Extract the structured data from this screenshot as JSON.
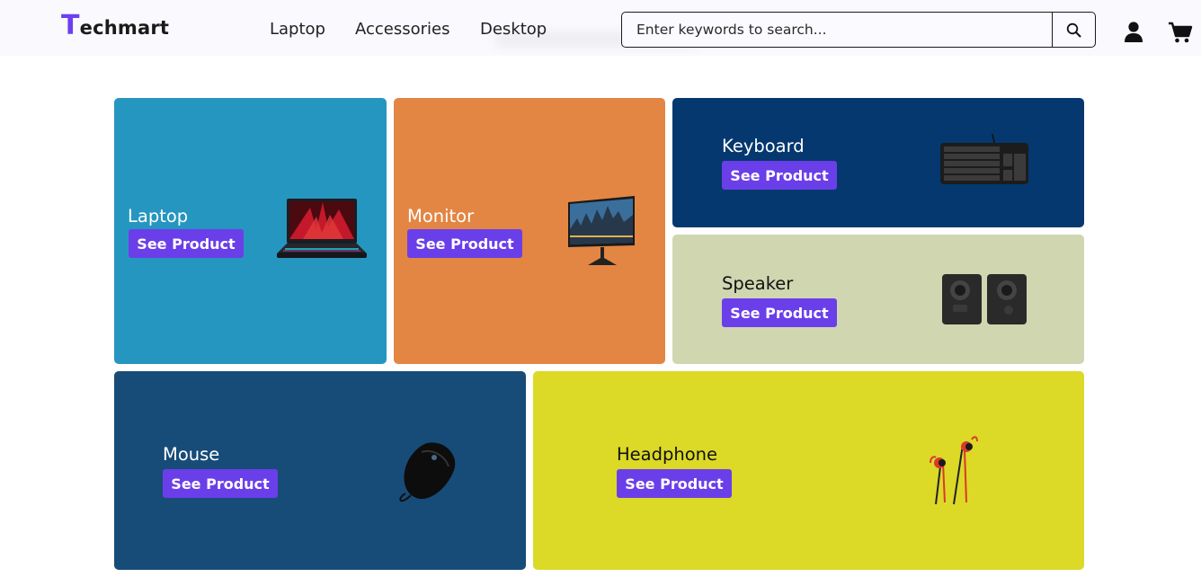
{
  "header": {
    "logo_first_letter": "T",
    "logo_rest": "echmart",
    "nav": [
      "Laptop",
      "Accessories",
      "Desktop"
    ],
    "search_placeholder": "Enter keywords to search...",
    "icons": {
      "search": "search-icon",
      "user": "user-icon",
      "cart": "cart-icon"
    }
  },
  "colors": {
    "accent": "#6a3fe9",
    "laptop_card": "#2596c0",
    "monitor_card": "#e38643",
    "keyboard_card": "#04386f",
    "speaker_card": "#d0d6b0",
    "mouse_card": "#174c78",
    "headphone_card": "#dcd927"
  },
  "categories": [
    {
      "name": "Laptop",
      "button": "See Product"
    },
    {
      "name": "Monitor",
      "button": "See Product"
    },
    {
      "name": "Keyboard",
      "button": "See Product"
    },
    {
      "name": "Speaker",
      "button": "See Product"
    },
    {
      "name": "Mouse",
      "button": "See Product"
    },
    {
      "name": "Headphone",
      "button": "See Product"
    }
  ]
}
